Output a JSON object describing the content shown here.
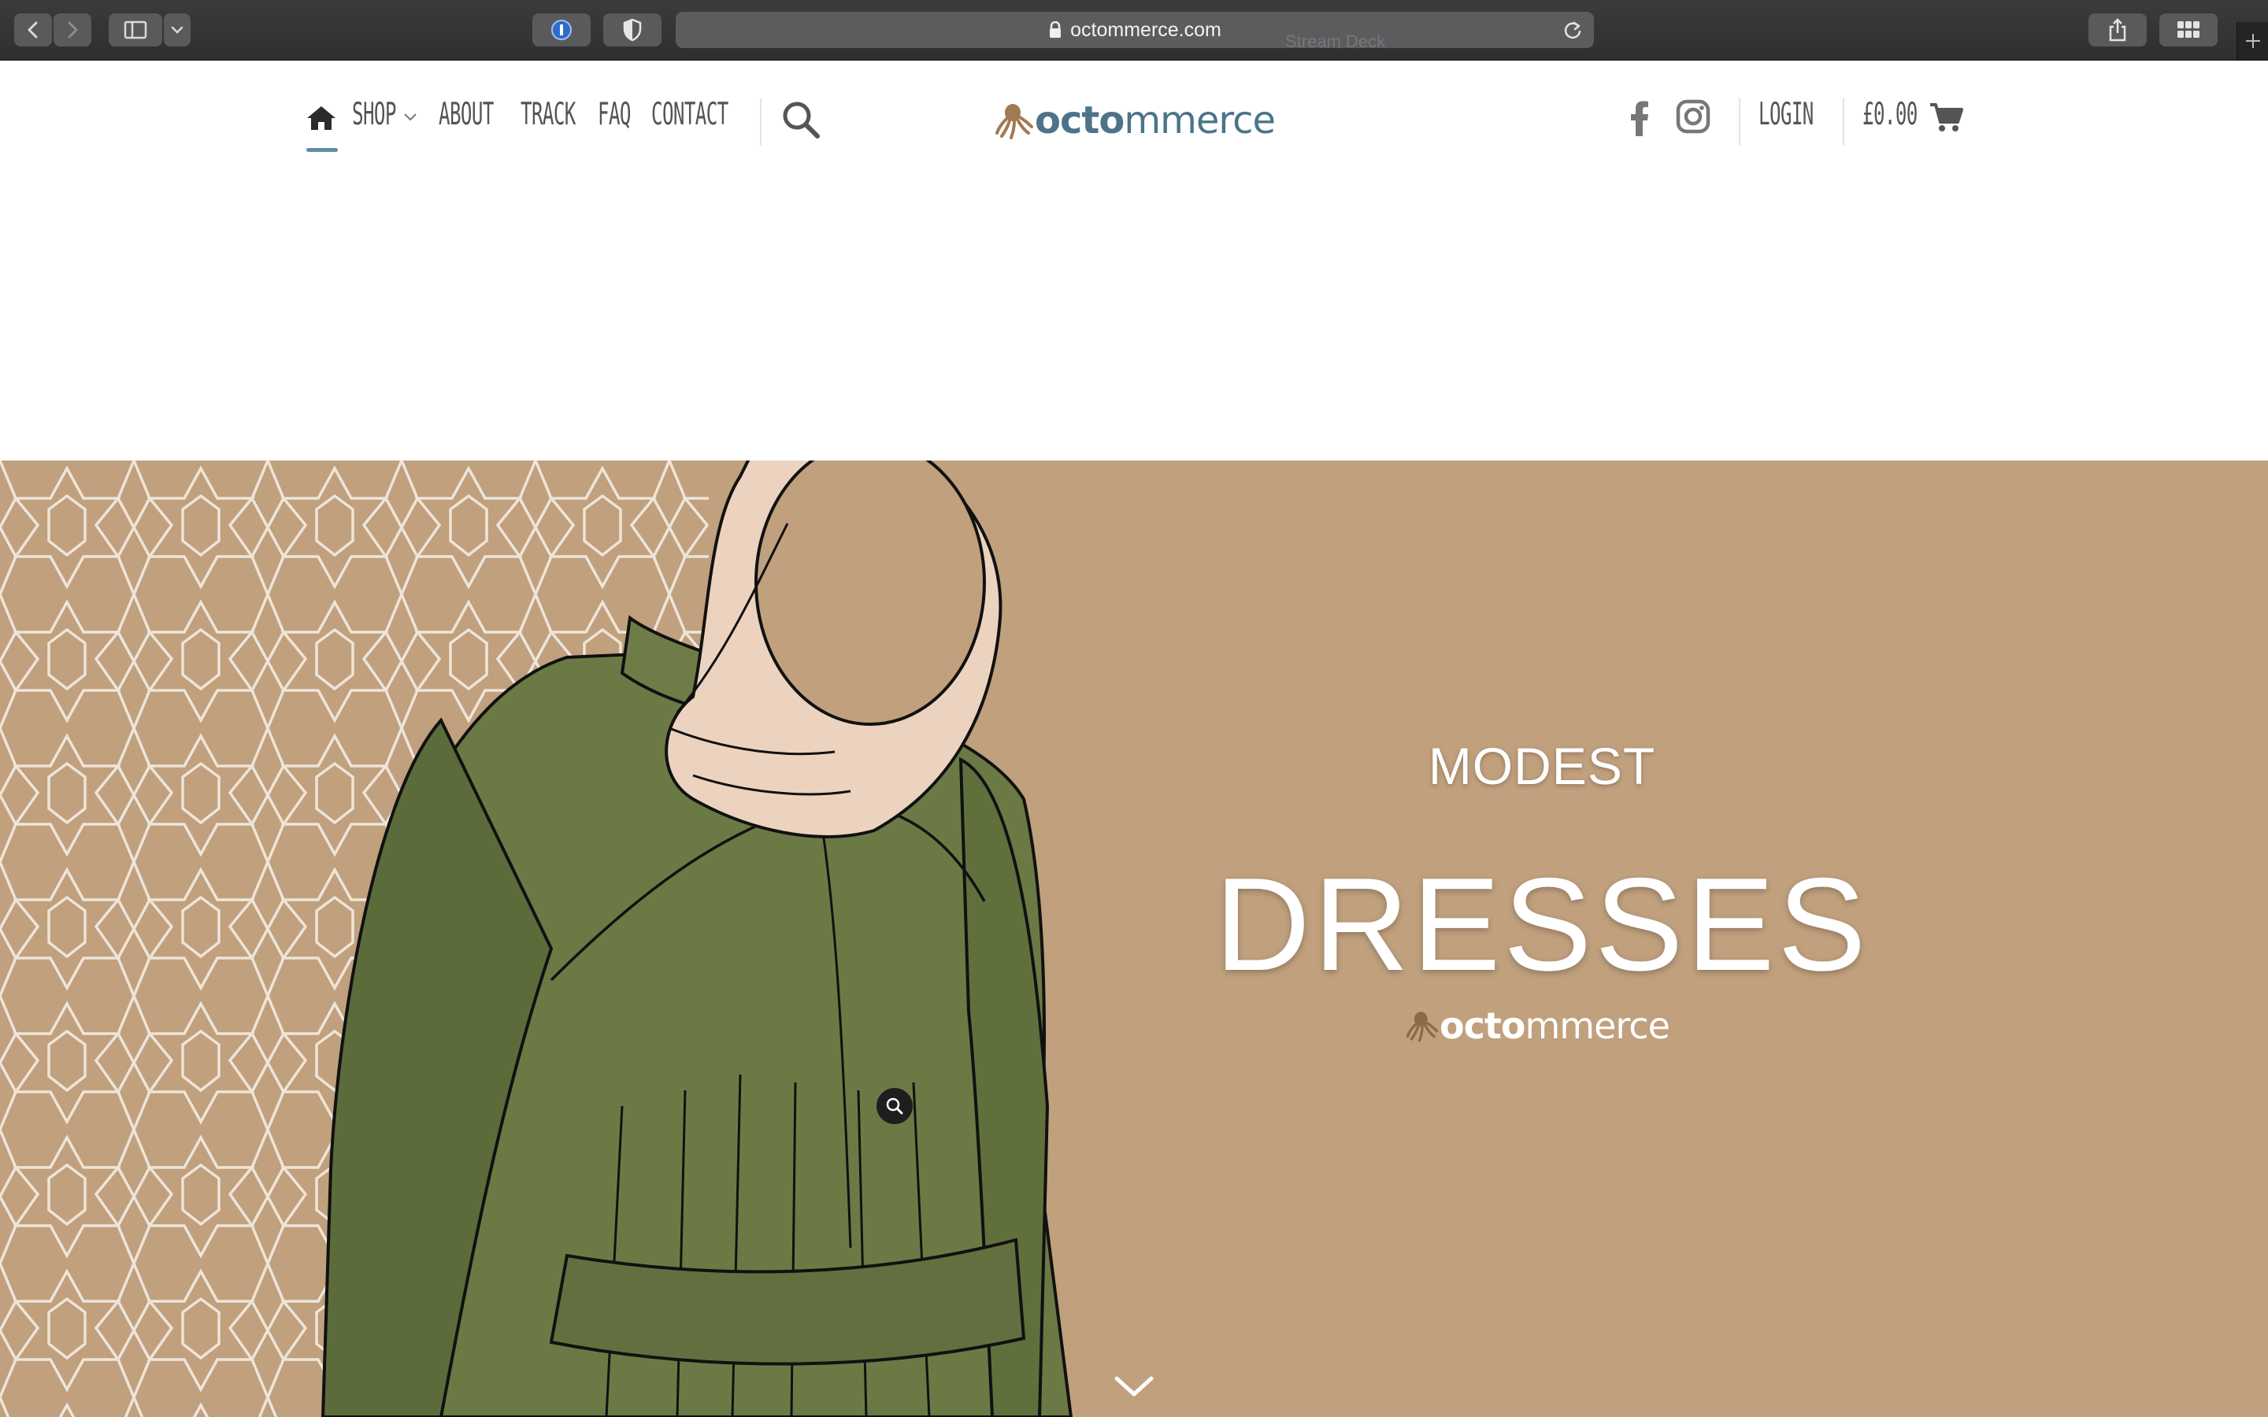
{
  "browser": {
    "url": "octommerce.com",
    "overlay_label": "Stream Deck"
  },
  "header": {
    "nav": {
      "shop": "SHOP",
      "about": "ABOUT",
      "track": "TRACK",
      "faq": "FAQ",
      "contact": "CONTACT"
    },
    "logo": {
      "bold": "octo",
      "light": "mmerce"
    },
    "login": "LOGIN",
    "cart_total": "£0.00"
  },
  "hero": {
    "line1": "MODEST",
    "line2": "DRESSES",
    "logo": {
      "bold": "octo",
      "light": "mmerce"
    }
  },
  "colors": {
    "accent": "#5f8fa3",
    "hero_background": "#c0a07d",
    "logo_blue": "#4c7489"
  },
  "icons": [
    "back-icon",
    "forward-icon",
    "sidebar-icon",
    "chevron-down-icon",
    "password-manager-icon",
    "privacy-shield-icon",
    "lock-icon",
    "reload-icon",
    "share-icon",
    "tab-overview-icon",
    "new-tab-icon",
    "home-icon",
    "search-icon",
    "facebook-icon",
    "instagram-icon",
    "cart-icon",
    "octopus-icon",
    "zoom-icon"
  ]
}
